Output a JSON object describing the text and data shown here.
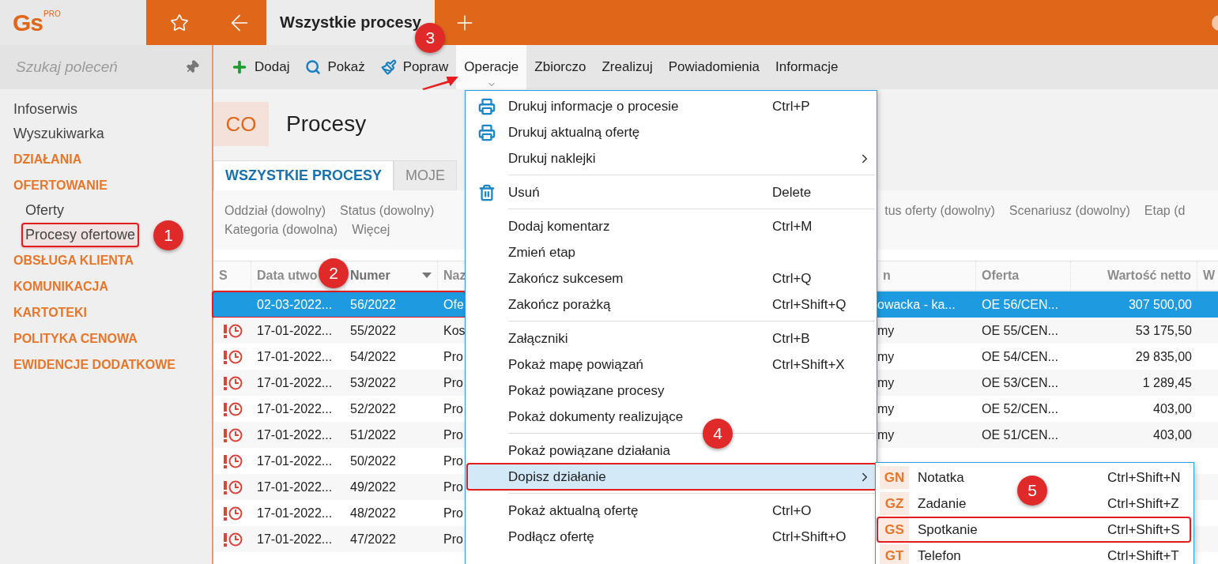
{
  "logo": {
    "text": "Gs",
    "badge": "PRO"
  },
  "top_bar": {
    "tab": {
      "label": "Wszystkie procesy",
      "selected": true
    }
  },
  "sidebar": {
    "search": {
      "placeholder": "Szukaj poleceń"
    },
    "items": [
      {
        "kind": "link",
        "label": "Infoserwis",
        "selected": false
      },
      {
        "kind": "link",
        "label": "Wyszukiwarka",
        "selected": false
      },
      {
        "kind": "section",
        "label": "DZIAŁANIA"
      },
      {
        "kind": "section",
        "label": "OFERTOWANIE",
        "children": [
          {
            "kind": "link",
            "label": "Oferty",
            "selected": false
          },
          {
            "kind": "link",
            "label": "Procesy ofertowe",
            "selected": true,
            "outlined": true,
            "callout": "1"
          }
        ]
      },
      {
        "kind": "section",
        "label": "OBSŁUGA KLIENTA"
      },
      {
        "kind": "section",
        "label": "KOMUNIKACJA"
      },
      {
        "kind": "section",
        "label": "KARTOTEKI"
      },
      {
        "kind": "section",
        "label": "POLITYKA CENOWA"
      },
      {
        "kind": "section",
        "label": "EWIDENCJE DODATKOWE"
      }
    ]
  },
  "toolbar": [
    {
      "kind": "add",
      "label": "Dodaj",
      "selected": false
    },
    {
      "kind": "search",
      "label": "Pokaż",
      "selected": false
    },
    {
      "kind": "edit",
      "label": "Popraw",
      "selected": false
    },
    {
      "kind": "plain",
      "label": "Operacje",
      "selected": true,
      "callout": "3"
    },
    {
      "kind": "plain",
      "label": "Zbiorczo",
      "selected": false
    },
    {
      "kind": "plain",
      "label": "Zrealizuj",
      "selected": false
    },
    {
      "kind": "plain",
      "label": "Powiadomienia",
      "selected": false
    },
    {
      "kind": "plain",
      "label": "Informacje",
      "selected": false
    }
  ],
  "header": {
    "badge": "CO",
    "title": "Procesy"
  },
  "tabs": [
    {
      "label": "WSZYSTKIE PROCESY",
      "selected": true
    },
    {
      "label": "MOJE",
      "selected": false
    }
  ],
  "filter_lines": [
    {
      "items": [
        "Oddział (dowolny)",
        "Status (dowolny)"
      ],
      "right_items": [
        "tus oferty (dowolny)",
        "Scenariusz (dowolny)",
        "Etap (d"
      ]
    },
    {
      "items": [
        "Kategoria (dowolna)",
        "Więcej"
      ]
    }
  ],
  "table": {
    "columns": [
      {
        "label": "S",
        "sorted": false
      },
      {
        "label": "Data utwo",
        "sorted": false
      },
      {
        "label": "Numer",
        "sorted": true
      },
      {
        "label": "Naz",
        "sorted": false
      },
      {
        "label": "n",
        "sorted": false
      },
      {
        "label": "Oferta",
        "sorted": false
      },
      {
        "label": "Wartość netto",
        "sorted": false
      },
      {
        "label": "W",
        "sorted": false
      }
    ],
    "rows": [
      {
        "overdue": false,
        "selected": true,
        "outlined": true,
        "callout": "2",
        "date": "02-03-2022...",
        "number": "56/2022",
        "name": "Ofe",
        "column_5": "owacka - ka...",
        "offer": "OE 56/CEN...",
        "net_value": "307 500,00"
      },
      {
        "overdue": true,
        "selected": false,
        "date": "17-01-2022...",
        "number": "55/2022",
        "name": "Kos",
        "column_5": "my",
        "offer": "OE 55/CEN...",
        "net_value": "53 175,50"
      },
      {
        "overdue": true,
        "selected": false,
        "date": "17-01-2022...",
        "number": "54/2022",
        "name": "Pro",
        "column_5": "my",
        "offer": "OE 54/CEN...",
        "net_value": "29 835,00"
      },
      {
        "overdue": true,
        "selected": false,
        "date": "17-01-2022...",
        "number": "53/2022",
        "name": "Pro",
        "column_5": "my",
        "offer": "OE 53/CEN...",
        "net_value": "1 289,45"
      },
      {
        "overdue": true,
        "selected": false,
        "date": "17-01-2022...",
        "number": "52/2022",
        "name": "Pro",
        "column_5": "my",
        "offer": "OE 52/CEN...",
        "net_value": "403,00"
      },
      {
        "overdue": true,
        "selected": false,
        "date": "17-01-2022...",
        "number": "51/2022",
        "name": "Pro",
        "column_5": "my",
        "offer": "OE 51/CEN...",
        "net_value": "403,00"
      },
      {
        "overdue": true,
        "selected": false,
        "date": "17-01-2022...",
        "number": "50/2022",
        "name": "Pro"
      },
      {
        "overdue": true,
        "selected": false,
        "date": "17-01-2022...",
        "number": "49/2022",
        "name": "Pro"
      },
      {
        "overdue": true,
        "selected": false,
        "date": "17-01-2022...",
        "number": "48/2022",
        "name": "Pro"
      },
      {
        "overdue": true,
        "selected": false,
        "date": "17-01-2022...",
        "number": "47/2022",
        "name": "Pro"
      }
    ]
  },
  "menu": [
    {
      "kind": "print",
      "label": "Drukuj informacje o procesie",
      "shortcut": "Ctrl+P",
      "selected": false
    },
    {
      "kind": "print",
      "label": "Drukuj aktualną ofertę",
      "selected": false
    },
    {
      "kind": "submenu",
      "label": "Drukuj naklejki",
      "selected": false
    },
    {
      "kind": "separator"
    },
    {
      "kind": "delete",
      "label": "Usuń",
      "shortcut": "Delete",
      "selected": false
    },
    {
      "kind": "separator"
    },
    {
      "kind": "plain",
      "label": "Dodaj komentarz",
      "shortcut": "Ctrl+M",
      "selected": false
    },
    {
      "kind": "plain",
      "label": "Zmień etap",
      "selected": false
    },
    {
      "kind": "plain",
      "label": "Zakończ sukcesem",
      "shortcut": "Ctrl+Q",
      "selected": false
    },
    {
      "kind": "plain",
      "label": "Zakończ porażką",
      "shortcut": "Ctrl+Shift+Q",
      "selected": false
    },
    {
      "kind": "separator"
    },
    {
      "kind": "plain",
      "label": "Załączniki",
      "shortcut": "Ctrl+B",
      "selected": false
    },
    {
      "kind": "plain",
      "label": "Pokaż mapę powiązań",
      "shortcut": "Ctrl+Shift+X",
      "selected": false
    },
    {
      "kind": "plain",
      "label": "Pokaż powiązane procesy",
      "selected": false
    },
    {
      "kind": "plain",
      "label": "Pokaż dokumenty realizujące",
      "selected": false
    },
    {
      "kind": "separator"
    },
    {
      "kind": "plain",
      "label": "Pokaż powiązane działania",
      "selected": false,
      "callout": "4"
    },
    {
      "kind": "submenu",
      "label": "Dopisz działanie",
      "selected": true,
      "outlined": true
    },
    {
      "kind": "separator"
    },
    {
      "kind": "plain",
      "label": "Pokaż aktualną ofertę",
      "shortcut": "Ctrl+O",
      "selected": false
    },
    {
      "kind": "plain",
      "label": "Podłącz ofertę",
      "shortcut": "Ctrl+Shift+O",
      "selected": false
    }
  ],
  "submenu": [
    {
      "code": "GN",
      "label": "Notatka",
      "shortcut": "Ctrl+Shift+N",
      "selected": false
    },
    {
      "code": "GZ",
      "label": "Zadanie",
      "shortcut": "Ctrl+Shift+Z",
      "selected": false,
      "callout": "5"
    },
    {
      "code": "GS",
      "label": "Spotkanie",
      "shortcut": "Ctrl+Shift+S",
      "selected": false,
      "outlined": true
    },
    {
      "code": "GT",
      "label": "Telefon",
      "shortcut": "Ctrl+Shift+T",
      "selected": false
    }
  ]
}
